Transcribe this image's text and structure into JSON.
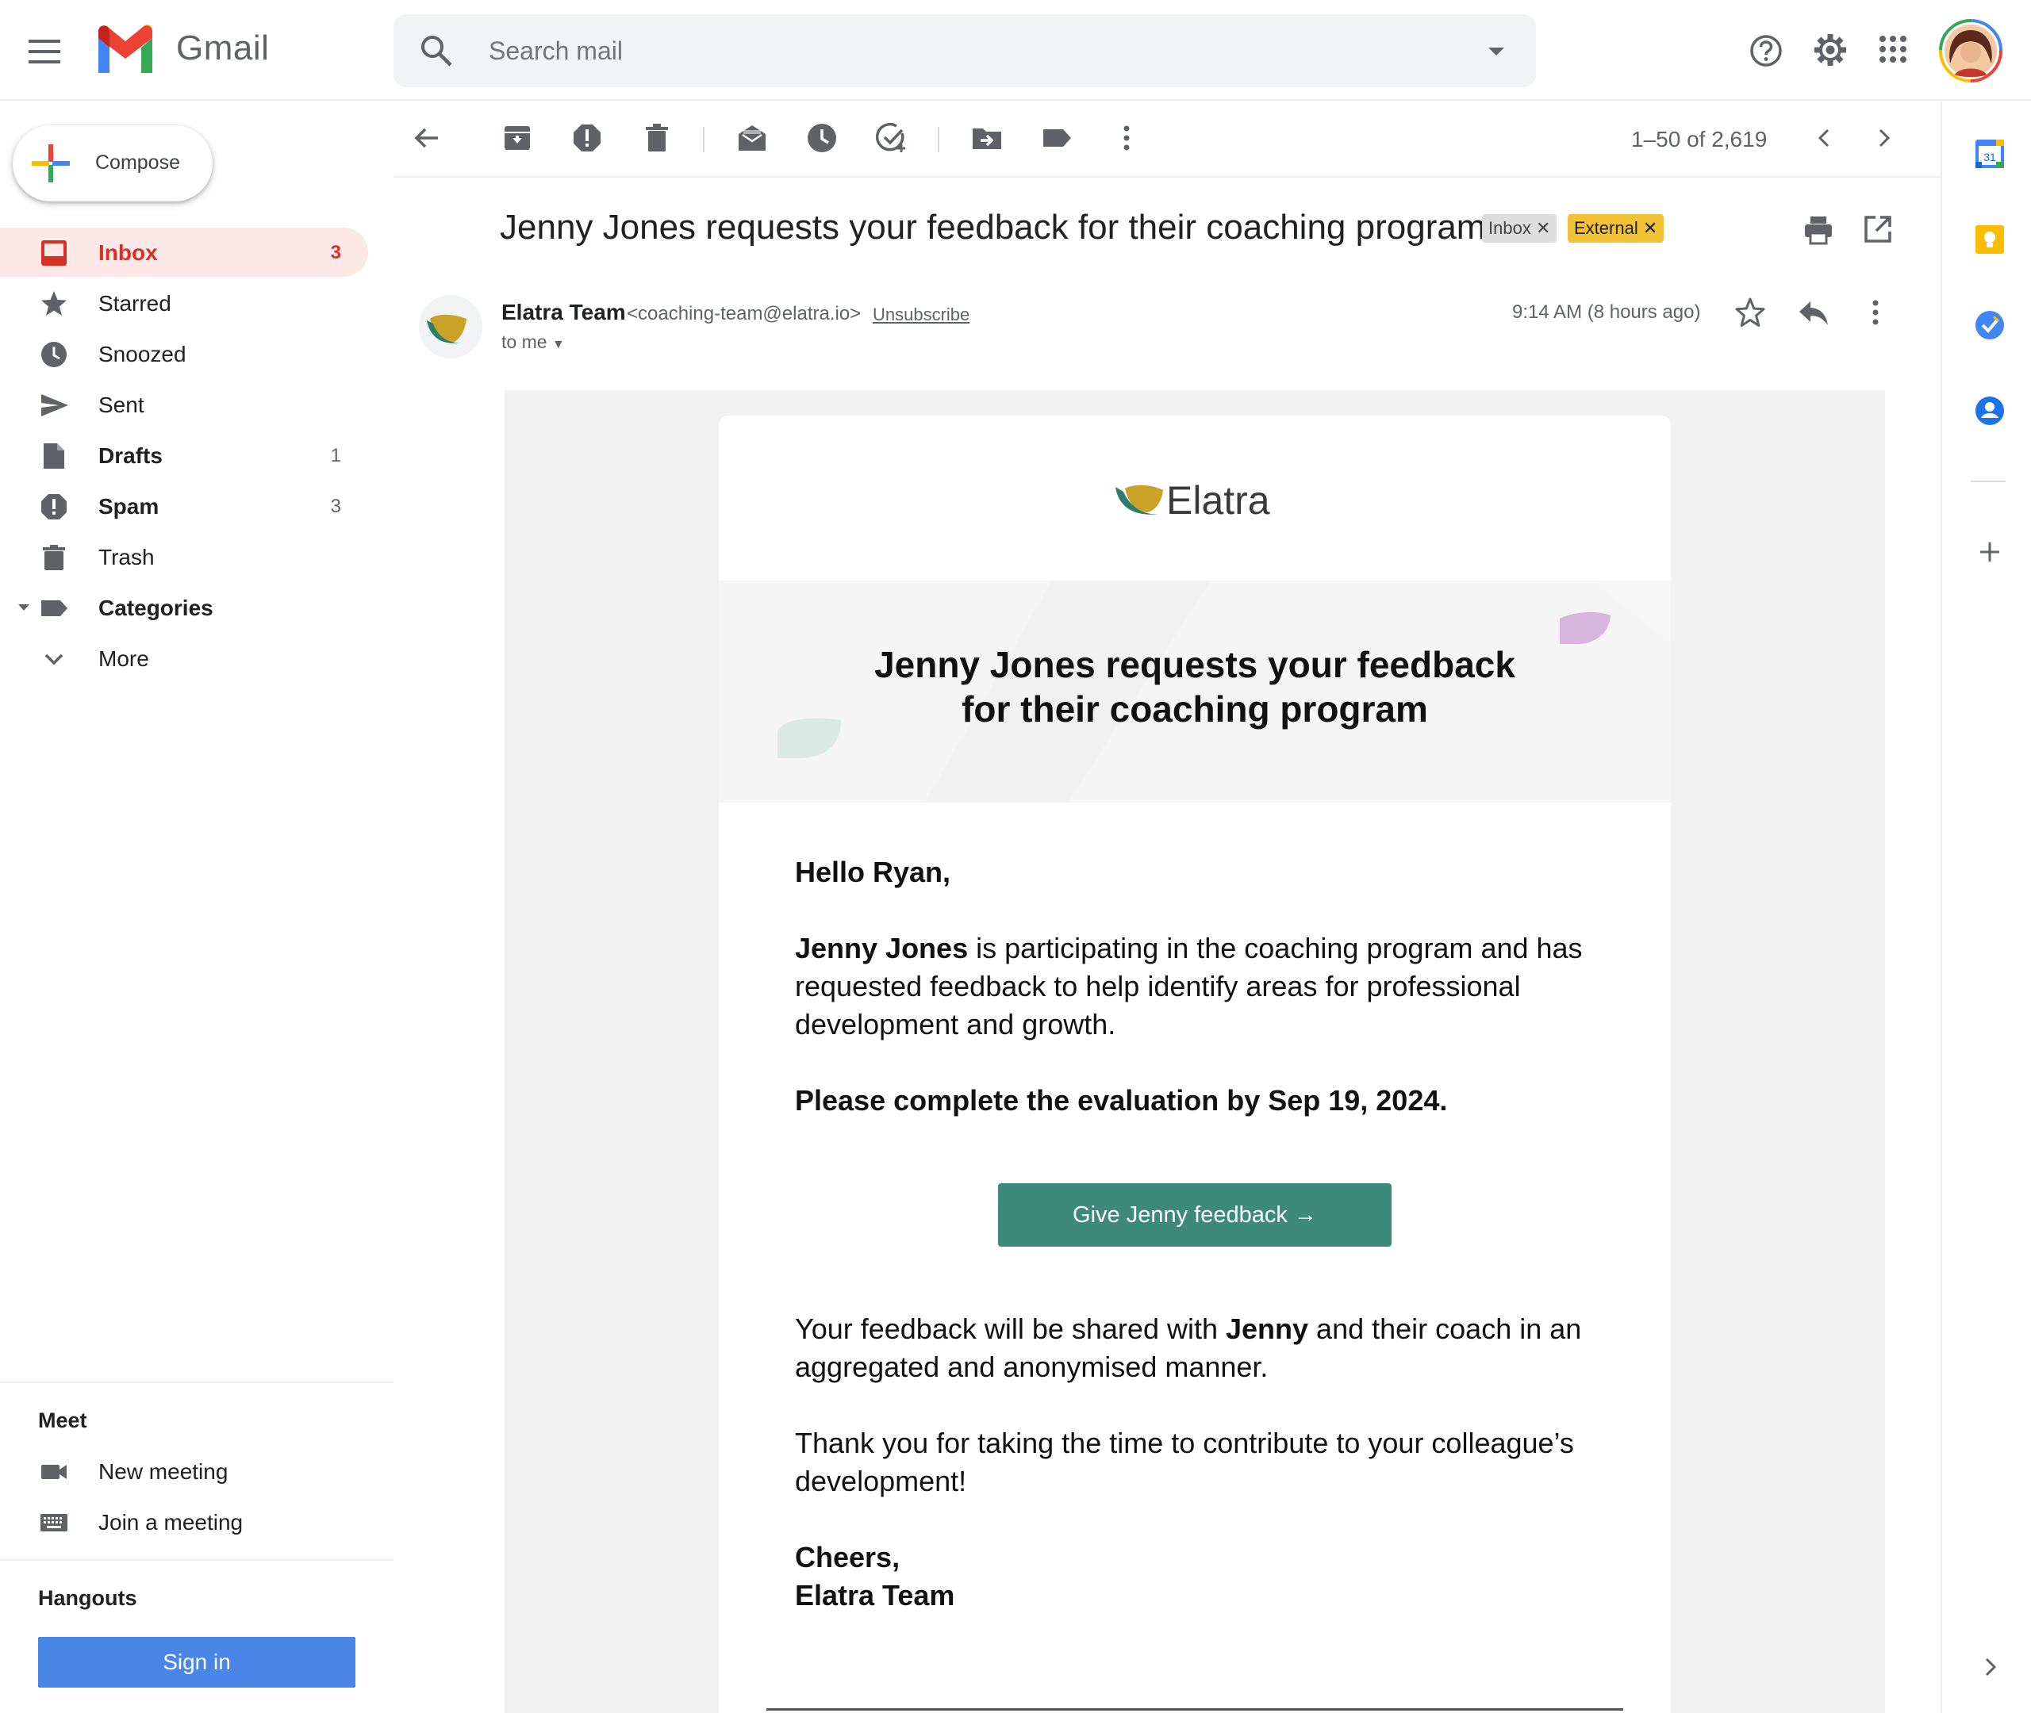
{
  "app": {
    "name": "Gmail"
  },
  "search": {
    "placeholder": "Search mail"
  },
  "compose": {
    "label": "Compose"
  },
  "sidebar": {
    "items": [
      {
        "label": "Inbox",
        "count": "3"
      },
      {
        "label": "Starred",
        "count": ""
      },
      {
        "label": "Snoozed",
        "count": ""
      },
      {
        "label": "Sent",
        "count": ""
      },
      {
        "label": "Drafts",
        "count": "1"
      },
      {
        "label": "Spam",
        "count": "3"
      },
      {
        "label": "Trash",
        "count": ""
      },
      {
        "label": "Categories",
        "count": ""
      },
      {
        "label": "More",
        "count": ""
      }
    ],
    "meet": {
      "title": "Meet",
      "new_meeting": "New meeting",
      "join_meeting": "Join a meeting"
    },
    "hangouts": {
      "title": "Hangouts",
      "sign_in": "Sign in"
    }
  },
  "toolbar": {
    "pagination": "1–50 of 2,619"
  },
  "email": {
    "subject": "Jenny Jones requests your feedback for their coaching program",
    "labels": {
      "inbox": "Inbox",
      "external": "External"
    },
    "sender_name": "Elatra Team",
    "sender_email": "<coaching-team@elatra.io>",
    "unsubscribe": "Unsubscribe",
    "to": "to me",
    "time": "9:14 AM (8 hours ago)",
    "body": {
      "brand": "Elatra",
      "hero_line1": "Jenny Jones requests your feedback",
      "hero_line2": "for their coaching program",
      "greeting": "Hello Ryan,",
      "p1_bold": "Jenny Jones",
      "p1_rest": " is participating in the coaching program and has requested feedback to help identify areas for professional development and growth.",
      "deadline": "Please complete the evaluation by Sep 19, 2024.",
      "cta": "Give Jenny feedback  →",
      "p2_a": "Your feedback will be shared with ",
      "p2_bold": "Jenny",
      "p2_b": " and their coach in an aggregated and anonymised manner.",
      "p3": "Thank you for taking the time to contribute to your colleague’s development!",
      "signoff1": "Cheers,",
      "signoff2": "Elatra Team"
    }
  },
  "colors": {
    "accent_red": "#d93025",
    "cta_green": "#3d8a78",
    "external_chip": "#f2c135",
    "signin_blue": "#4a86e8"
  },
  "icons": [
    "menu-icon",
    "gmail-logo",
    "search-icon",
    "help-icon",
    "gear-icon",
    "apps-icon",
    "archive-icon",
    "report-spam-icon",
    "delete-icon",
    "mark-unread-icon",
    "snooze-icon",
    "add-task-icon",
    "move-to-icon",
    "label-icon",
    "more-vert-icon",
    "print-icon",
    "open-new-window-icon",
    "star-icon",
    "reply-icon",
    "calendar-icon",
    "keep-icon",
    "tasks-icon",
    "contacts-icon",
    "plus-icon"
  ]
}
